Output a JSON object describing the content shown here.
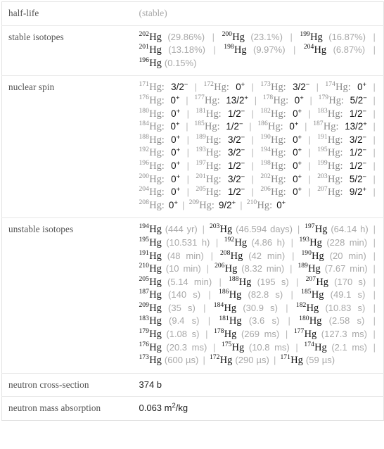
{
  "table": {
    "rows": [
      {
        "label": "half-life",
        "kind": "note",
        "value": "(stable)"
      },
      {
        "label": "stable isotopes",
        "kind": "isolist"
      },
      {
        "label": "nuclear spin",
        "kind": "spinlist"
      },
      {
        "label": "unstable isotopes",
        "kind": "isolist2"
      },
      {
        "label": "neutron cross-section",
        "kind": "plain",
        "value": "374 b"
      },
      {
        "label": "neutron mass absorption",
        "kind": "sup",
        "value_pre": "0.063 m",
        "value_sup": "2",
        "value_post": "/kg"
      }
    ]
  },
  "stable_isotopes": {
    "element": "Hg",
    "items": [
      {
        "mass": "202",
        "symbol": "Hg",
        "detail": "(29.86%)"
      },
      {
        "mass": "200",
        "symbol": "Hg",
        "detail": "(23.1%)"
      },
      {
        "mass": "199",
        "symbol": "Hg",
        "detail": "(16.87%)"
      },
      {
        "mass": "201",
        "symbol": "Hg",
        "detail": "(13.18%)"
      },
      {
        "mass": "198",
        "symbol": "Hg",
        "detail": "(9.97%)"
      },
      {
        "mass": "204",
        "symbol": "Hg",
        "detail": "(6.87%)"
      },
      {
        "mass": "196",
        "symbol": "Hg",
        "detail": "(0.15%)"
      }
    ]
  },
  "nuclear_spin": {
    "element": "Hg",
    "items": [
      {
        "mass": "171",
        "symbol": "Hg",
        "spin": "3/2",
        "sign": "-"
      },
      {
        "mass": "172",
        "symbol": "Hg",
        "spin": "0",
        "sign": "+"
      },
      {
        "mass": "173",
        "symbol": "Hg",
        "spin": "3/2",
        "sign": "-"
      },
      {
        "mass": "174",
        "symbol": "Hg",
        "spin": "0",
        "sign": "+"
      },
      {
        "mass": "176",
        "symbol": "Hg",
        "spin": "0",
        "sign": "+"
      },
      {
        "mass": "177",
        "symbol": "Hg",
        "spin": "13/2",
        "sign": "+"
      },
      {
        "mass": "178",
        "symbol": "Hg",
        "spin": "0",
        "sign": "+"
      },
      {
        "mass": "179",
        "symbol": "Hg",
        "spin": "5/2",
        "sign": "-"
      },
      {
        "mass": "180",
        "symbol": "Hg",
        "spin": "0",
        "sign": "+"
      },
      {
        "mass": "181",
        "symbol": "Hg",
        "spin": "1/2",
        "sign": "-"
      },
      {
        "mass": "182",
        "symbol": "Hg",
        "spin": "0",
        "sign": "+"
      },
      {
        "mass": "183",
        "symbol": "Hg",
        "spin": "1/2",
        "sign": "-"
      },
      {
        "mass": "184",
        "symbol": "Hg",
        "spin": "0",
        "sign": "+"
      },
      {
        "mass": "185",
        "symbol": "Hg",
        "spin": "1/2",
        "sign": "-"
      },
      {
        "mass": "186",
        "symbol": "Hg",
        "spin": "0",
        "sign": "+"
      },
      {
        "mass": "187",
        "symbol": "Hg",
        "spin": "13/2",
        "sign": "+"
      },
      {
        "mass": "188",
        "symbol": "Hg",
        "spin": "0",
        "sign": "+"
      },
      {
        "mass": "189",
        "symbol": "Hg",
        "spin": "3/2",
        "sign": "-"
      },
      {
        "mass": "190",
        "symbol": "Hg",
        "spin": "0",
        "sign": "+"
      },
      {
        "mass": "191",
        "symbol": "Hg",
        "spin": "3/2",
        "sign": "-"
      },
      {
        "mass": "192",
        "symbol": "Hg",
        "spin": "0",
        "sign": "+"
      },
      {
        "mass": "193",
        "symbol": "Hg",
        "spin": "3/2",
        "sign": "-"
      },
      {
        "mass": "194",
        "symbol": "Hg",
        "spin": "0",
        "sign": "+"
      },
      {
        "mass": "195",
        "symbol": "Hg",
        "spin": "1/2",
        "sign": "-"
      },
      {
        "mass": "196",
        "symbol": "Hg",
        "spin": "0",
        "sign": "+"
      },
      {
        "mass": "197",
        "symbol": "Hg",
        "spin": "1/2",
        "sign": "-"
      },
      {
        "mass": "198",
        "symbol": "Hg",
        "spin": "0",
        "sign": "+"
      },
      {
        "mass": "199",
        "symbol": "Hg",
        "spin": "1/2",
        "sign": "-"
      },
      {
        "mass": "200",
        "symbol": "Hg",
        "spin": "0",
        "sign": "+"
      },
      {
        "mass": "201",
        "symbol": "Hg",
        "spin": "3/2",
        "sign": "-"
      },
      {
        "mass": "202",
        "symbol": "Hg",
        "spin": "0",
        "sign": "+"
      },
      {
        "mass": "203",
        "symbol": "Hg",
        "spin": "5/2",
        "sign": "-"
      },
      {
        "mass": "204",
        "symbol": "Hg",
        "spin": "0",
        "sign": "+"
      },
      {
        "mass": "205",
        "symbol": "Hg",
        "spin": "1/2",
        "sign": "-"
      },
      {
        "mass": "206",
        "symbol": "Hg",
        "spin": "0",
        "sign": "+"
      },
      {
        "mass": "207",
        "symbol": "Hg",
        "spin": "9/2",
        "sign": "+"
      },
      {
        "mass": "208",
        "symbol": "Hg",
        "spin": "0",
        "sign": "+"
      },
      {
        "mass": "209",
        "symbol": "Hg",
        "spin": "9/2",
        "sign": "+"
      },
      {
        "mass": "210",
        "symbol": "Hg",
        "spin": "0",
        "sign": "+"
      }
    ]
  },
  "unstable_isotopes": {
    "element": "Hg",
    "items": [
      {
        "mass": "194",
        "symbol": "Hg",
        "detail": "(444 yr)"
      },
      {
        "mass": "203",
        "symbol": "Hg",
        "detail": "(46.594 days)"
      },
      {
        "mass": "197",
        "symbol": "Hg",
        "detail": "(64.14 h)"
      },
      {
        "mass": "195",
        "symbol": "Hg",
        "detail": "(10.531 h)"
      },
      {
        "mass": "192",
        "symbol": "Hg",
        "detail": "(4.86 h)"
      },
      {
        "mass": "193",
        "symbol": "Hg",
        "detail": "(228 min)"
      },
      {
        "mass": "191",
        "symbol": "Hg",
        "detail": "(48 min)"
      },
      {
        "mass": "208",
        "symbol": "Hg",
        "detail": "(42 min)"
      },
      {
        "mass": "190",
        "symbol": "Hg",
        "detail": "(20 min)"
      },
      {
        "mass": "210",
        "symbol": "Hg",
        "detail": "(10 min)"
      },
      {
        "mass": "206",
        "symbol": "Hg",
        "detail": "(8.32 min)"
      },
      {
        "mass": "189",
        "symbol": "Hg",
        "detail": "(7.67 min)"
      },
      {
        "mass": "205",
        "symbol": "Hg",
        "detail": "(5.14 min)"
      },
      {
        "mass": "188",
        "symbol": "Hg",
        "detail": "(195 s)"
      },
      {
        "mass": "207",
        "symbol": "Hg",
        "detail": "(170 s)"
      },
      {
        "mass": "187",
        "symbol": "Hg",
        "detail": "(140 s)"
      },
      {
        "mass": "186",
        "symbol": "Hg",
        "detail": "(82.8 s)"
      },
      {
        "mass": "185",
        "symbol": "Hg",
        "detail": "(49.1 s)"
      },
      {
        "mass": "209",
        "symbol": "Hg",
        "detail": "(35 s)"
      },
      {
        "mass": "184",
        "symbol": "Hg",
        "detail": "(30.9 s)"
      },
      {
        "mass": "182",
        "symbol": "Hg",
        "detail": "(10.83 s)"
      },
      {
        "mass": "183",
        "symbol": "Hg",
        "detail": "(9.4 s)"
      },
      {
        "mass": "181",
        "symbol": "Hg",
        "detail": "(3.6 s)"
      },
      {
        "mass": "180",
        "symbol": "Hg",
        "detail": "(2.58 s)"
      },
      {
        "mass": "179",
        "symbol": "Hg",
        "detail": "(1.08 s)"
      },
      {
        "mass": "178",
        "symbol": "Hg",
        "detail": "(269 ms)"
      },
      {
        "mass": "177",
        "symbol": "Hg",
        "detail": "(127.3 ms)"
      },
      {
        "mass": "176",
        "symbol": "Hg",
        "detail": "(20.3 ms)"
      },
      {
        "mass": "175",
        "symbol": "Hg",
        "detail": "(10.8 ms)"
      },
      {
        "mass": "174",
        "symbol": "Hg",
        "detail": "(2.1 ms)"
      },
      {
        "mass": "173",
        "symbol": "Hg",
        "detail": "(600 µs)"
      },
      {
        "mass": "172",
        "symbol": "Hg",
        "detail": "(290 µs)"
      },
      {
        "mass": "171",
        "symbol": "Hg",
        "detail": "(59 µs)"
      }
    ]
  },
  "separator": "|"
}
